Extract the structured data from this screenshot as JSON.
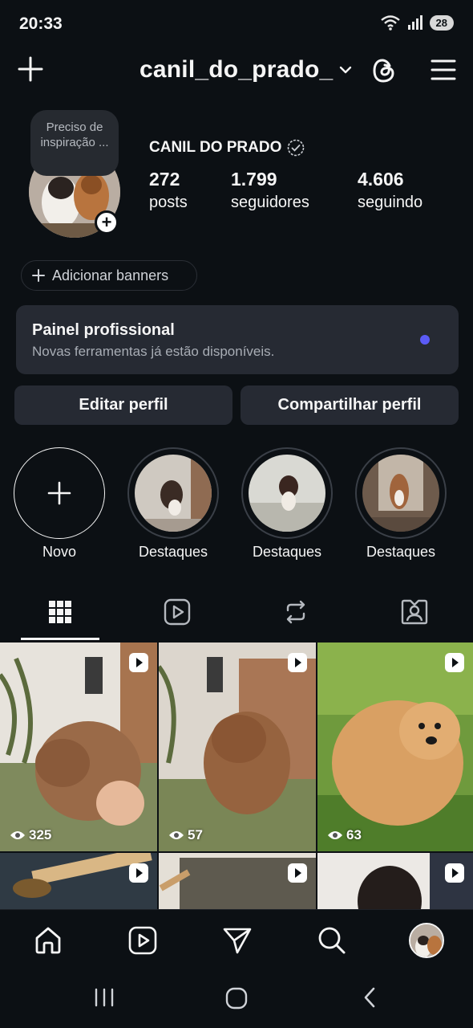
{
  "status_bar": {
    "time": "20:33",
    "battery": "28"
  },
  "header": {
    "username": "canil_do_prado_"
  },
  "profile": {
    "note": "Preciso de inspiração ...",
    "display_name": "CANIL DO PRADO",
    "stats": [
      {
        "value": "272",
        "label": "posts"
      },
      {
        "value": "1.799",
        "label": "seguidores"
      },
      {
        "value": "4.606",
        "label": "seguindo"
      }
    ]
  },
  "banner_button": {
    "label": "Adicionar banners"
  },
  "pro_panel": {
    "title": "Painel profissional",
    "subtitle": "Novas ferramentas já estão disponíveis.",
    "dot_color": "#5b5bf6"
  },
  "actions": {
    "edit": "Editar perfil",
    "share": "Compartilhar perfil"
  },
  "highlights": [
    {
      "label": "Novo"
    },
    {
      "label": "Destaques"
    },
    {
      "label": "Destaques"
    },
    {
      "label": "Destaques"
    }
  ],
  "tabs": [
    "grid-icon",
    "reels-icon",
    "reposts-icon",
    "tagged-icon"
  ],
  "grid": {
    "items": [
      {
        "views": "325",
        "type": "reel"
      },
      {
        "views": "57",
        "type": "reel"
      },
      {
        "views": "63",
        "type": "reel"
      },
      {
        "views": "",
        "type": "reel"
      },
      {
        "views": "",
        "type": "reel"
      },
      {
        "views": "",
        "type": "reel"
      }
    ]
  },
  "bottom_nav": [
    "home-icon",
    "reels-icon",
    "send-icon",
    "search-icon",
    "profile-avatar"
  ],
  "colors": {
    "background": "#0c1014",
    "card": "#262a33",
    "accent_dot": "#5b5bf6"
  }
}
